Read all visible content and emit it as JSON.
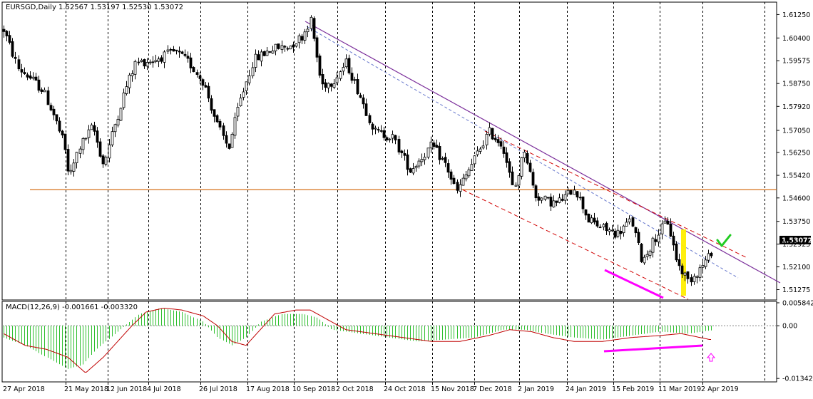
{
  "chart_data": [
    {
      "type": "candlestick",
      "title": "EURSGD,Daily  1.52567 1.53197 1.52530 1.53072",
      "price_axis": {
        "range": [
          1.509,
          1.617
        ],
        "ticks": [
          "1.61250",
          "1.60400",
          "1.59575",
          "1.58750",
          "1.57920",
          "1.57050",
          "1.56250",
          "1.55420",
          "1.54600",
          "1.53750",
          "1.52925",
          "1.52100",
          "1.51275"
        ],
        "current_price_label": "1.53072"
      },
      "date_axis": {
        "ticks": [
          "27 Apr 2018",
          "21 May 2018",
          "12 Jun 2018",
          "4 Jul 2018",
          "26 Jul 2018",
          "17 Aug 2018",
          "10 Sep 2018",
          "2 Oct 2018",
          "24 Oct 2018",
          "15 Nov 2018",
          "7 Dec 2018",
          "2 Jan 2019",
          "24 Jan 2019",
          "15 Feb 2019",
          "11 Mar 2019",
          "2 Apr 2019"
        ]
      },
      "close_path_approx": [
        [
          0,
          1.607
        ],
        [
          20,
          1.593
        ],
        [
          35,
          1.59
        ],
        [
          55,
          1.585
        ],
        [
          70,
          1.576
        ],
        [
          85,
          1.565
        ],
        [
          92,
          1.553
        ],
        [
          105,
          1.564
        ],
        [
          125,
          1.572
        ],
        [
          140,
          1.558
        ],
        [
          155,
          1.572
        ],
        [
          170,
          1.585
        ],
        [
          185,
          1.595
        ],
        [
          210,
          1.596
        ],
        [
          240,
          1.599
        ],
        [
          260,
          1.595
        ],
        [
          280,
          1.588
        ],
        [
          300,
          1.572
        ],
        [
          315,
          1.564
        ],
        [
          330,
          1.58
        ],
        [
          350,
          1.596
        ],
        [
          375,
          1.6
        ],
        [
          400,
          1.601
        ],
        [
          420,
          1.605
        ],
        [
          430,
          1.611
        ],
        [
          445,
          1.587
        ],
        [
          460,
          1.588
        ],
        [
          480,
          1.595
        ],
        [
          500,
          1.583
        ],
        [
          520,
          1.57
        ],
        [
          545,
          1.568
        ],
        [
          570,
          1.556
        ],
        [
          600,
          1.565
        ],
        [
          620,
          1.558
        ],
        [
          635,
          1.548
        ],
        [
          660,
          1.56
        ],
        [
          680,
          1.57
        ],
        [
          700,
          1.565
        ],
        [
          715,
          1.548
        ],
        [
          730,
          1.564
        ],
        [
          745,
          1.547
        ],
        [
          760,
          1.545
        ],
        [
          775,
          1.544
        ],
        [
          790,
          1.547
        ],
        [
          800,
          1.55
        ],
        [
          820,
          1.538
        ],
        [
          840,
          1.535
        ],
        [
          860,
          1.533
        ],
        [
          880,
          1.538
        ],
        [
          895,
          1.523
        ],
        [
          910,
          1.53
        ],
        [
          930,
          1.538
        ],
        [
          945,
          1.522
        ],
        [
          960,
          1.516
        ],
        [
          975,
          1.52
        ],
        [
          990,
          1.525
        ],
        [
          998,
          1.5307
        ]
      ],
      "support_line": {
        "price": 1.549
      },
      "annotations": [
        "checkmark",
        "yellow-highlight-bar",
        "magenta-divergence-line-price"
      ]
    },
    {
      "type": "macd",
      "title": "MACD(12,26,9) -0.001661 -0.003320",
      "value_axis": {
        "range": [
          -0.0143,
          0.0062
        ],
        "ticks": [
          "0.005842",
          "0.00",
          "-0.013422"
        ]
      },
      "histogram_approx": [
        [
          0,
          -0.003
        ],
        [
          30,
          -0.005
        ],
        [
          60,
          -0.008
        ],
        [
          90,
          -0.011
        ],
        [
          110,
          -0.01
        ],
        [
          130,
          -0.006
        ],
        [
          150,
          -0.003
        ],
        [
          170,
          0.0
        ],
        [
          190,
          0.003
        ],
        [
          220,
          0.0045
        ],
        [
          250,
          0.0035
        ],
        [
          280,
          0.001
        ],
        [
          300,
          -0.003
        ],
        [
          320,
          -0.005
        ],
        [
          340,
          -0.003
        ],
        [
          360,
          0.001
        ],
        [
          390,
          0.003
        ],
        [
          420,
          0.003
        ],
        [
          440,
          0.002
        ],
        [
          460,
          -0.001
        ],
        [
          500,
          -0.002
        ],
        [
          540,
          -0.003
        ],
        [
          580,
          -0.004
        ],
        [
          620,
          -0.0035
        ],
        [
          660,
          -0.003
        ],
        [
          700,
          -0.001
        ],
        [
          730,
          -0.001
        ],
        [
          760,
          -0.002
        ],
        [
          800,
          -0.003
        ],
        [
          840,
          -0.0035
        ],
        [
          880,
          -0.0025
        ],
        [
          920,
          -0.0015
        ],
        [
          960,
          -0.002
        ],
        [
          990,
          -0.0012
        ]
      ],
      "signal_approx": [
        [
          0,
          -0.002
        ],
        [
          30,
          -0.005
        ],
        [
          60,
          -0.006
        ],
        [
          90,
          -0.008
        ],
        [
          115,
          -0.012
        ],
        [
          140,
          -0.008
        ],
        [
          160,
          -0.004
        ],
        [
          180,
          0.0
        ],
        [
          200,
          0.0035
        ],
        [
          225,
          0.0045
        ],
        [
          250,
          0.004
        ],
        [
          280,
          0.0025
        ],
        [
          300,
          0.0
        ],
        [
          320,
          -0.004
        ],
        [
          340,
          -0.005
        ],
        [
          360,
          -0.001
        ],
        [
          380,
          0.003
        ],
        [
          410,
          0.004
        ],
        [
          430,
          0.004
        ],
        [
          450,
          0.002
        ],
        [
          480,
          -0.001
        ],
        [
          520,
          -0.002
        ],
        [
          560,
          -0.003
        ],
        [
          600,
          -0.004
        ],
        [
          640,
          -0.004
        ],
        [
          680,
          -0.0025
        ],
        [
          710,
          -0.001
        ],
        [
          740,
          -0.0015
        ],
        [
          770,
          -0.003
        ],
        [
          800,
          -0.004
        ],
        [
          840,
          -0.004
        ],
        [
          880,
          -0.003
        ],
        [
          920,
          -0.0025
        ],
        [
          950,
          -0.002
        ],
        [
          990,
          -0.0035
        ]
      ]
    }
  ],
  "colors": {
    "bg": "#ffffff",
    "candle": "#000000",
    "grid": "#000000",
    "support": "#d06000",
    "channel_purple": "#7b2f9b",
    "channel_red": "#d10000",
    "channel_blue_dash": "#6677cc",
    "magenta": "#ff00ff",
    "yellow": "#ffee00",
    "macd_hist": "#2fbf2f",
    "macd_signal": "#c00000",
    "check": "#22cc22"
  }
}
